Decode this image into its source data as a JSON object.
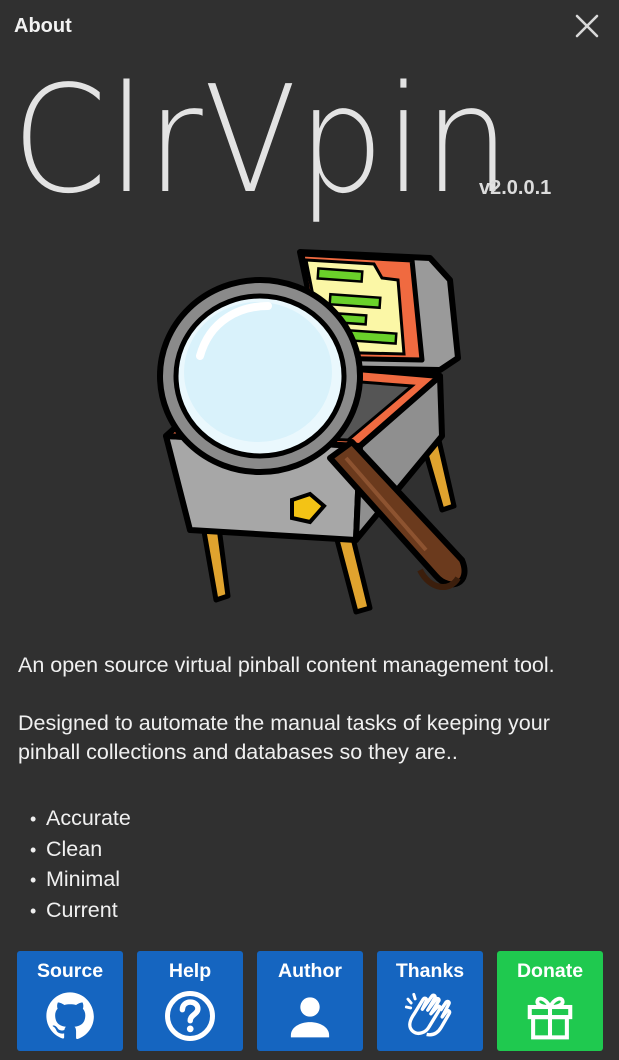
{
  "window": {
    "title": "About",
    "close_icon": "close-icon"
  },
  "app": {
    "name": "ClrVpin",
    "version": "v2.0.0.1",
    "logo": "magnifying-glass-over-pinball-machine"
  },
  "description": {
    "intro": "An open source virtual pinball content management tool.",
    "purpose": "Designed to automate the manual tasks of keeping your pinball collections and databases so they are..",
    "bullets": [
      "Accurate",
      "Clean",
      "Minimal",
      "Current"
    ]
  },
  "buttons": [
    {
      "label": "Source",
      "icon": "github-icon",
      "color": "#1565c0"
    },
    {
      "label": "Help",
      "icon": "help-circle-icon",
      "color": "#1565c0"
    },
    {
      "label": "Author",
      "icon": "person-icon",
      "color": "#1565c0"
    },
    {
      "label": "Thanks",
      "icon": "clapping-hands-icon",
      "color": "#1565c0"
    },
    {
      "label": "Donate",
      "icon": "gift-icon",
      "color": "#1fc94f"
    }
  ]
}
